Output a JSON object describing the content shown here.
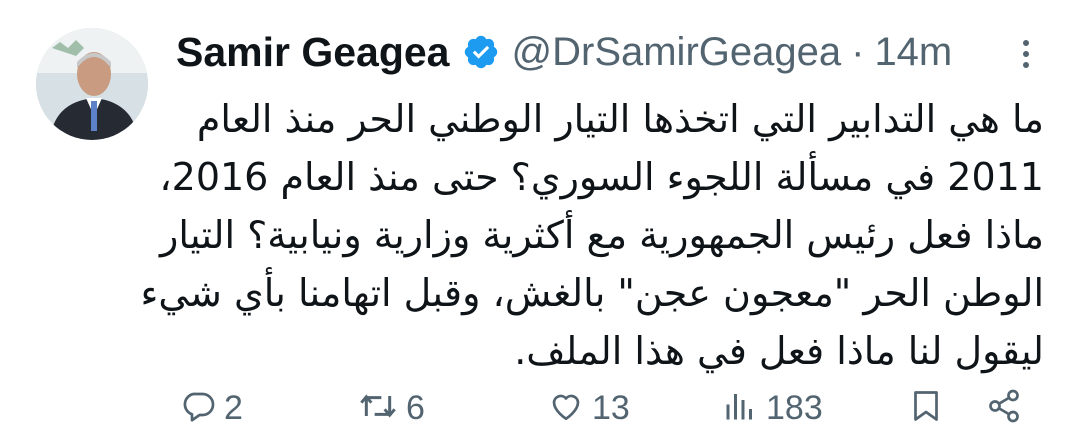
{
  "tweet": {
    "author_name": "Samir Geagea",
    "handle": "@DrSamirGeagea",
    "separator": "·",
    "time": "14m",
    "body_lines": [
      "ما هي التدابير التي اتخذها التيار الوطني الحر منذ العام",
      "2011 في مسألة اللجوء السوري؟ حتى منذ العام 2016،",
      "ماذا فعل رئيس الجمهورية مع أكثرية وزارية ونيابية؟ التيار",
      "الوطن الحر \"معجون عجن\" بالغش، وقبل اتهامنا بأي شيء",
      "ليقول لنا ماذا فعل في هذا الملف."
    ]
  },
  "actions": {
    "replies": "2",
    "retweets": "6",
    "likes": "13",
    "views": "183"
  },
  "colors": {
    "text": "#0f1419",
    "secondary": "#536471",
    "verified": "#1d9bf0"
  },
  "icons": [
    "verified-badge-icon",
    "more-icon",
    "reply-icon",
    "retweet-icon",
    "like-icon",
    "views-icon",
    "bookmark-icon",
    "share-icon"
  ]
}
